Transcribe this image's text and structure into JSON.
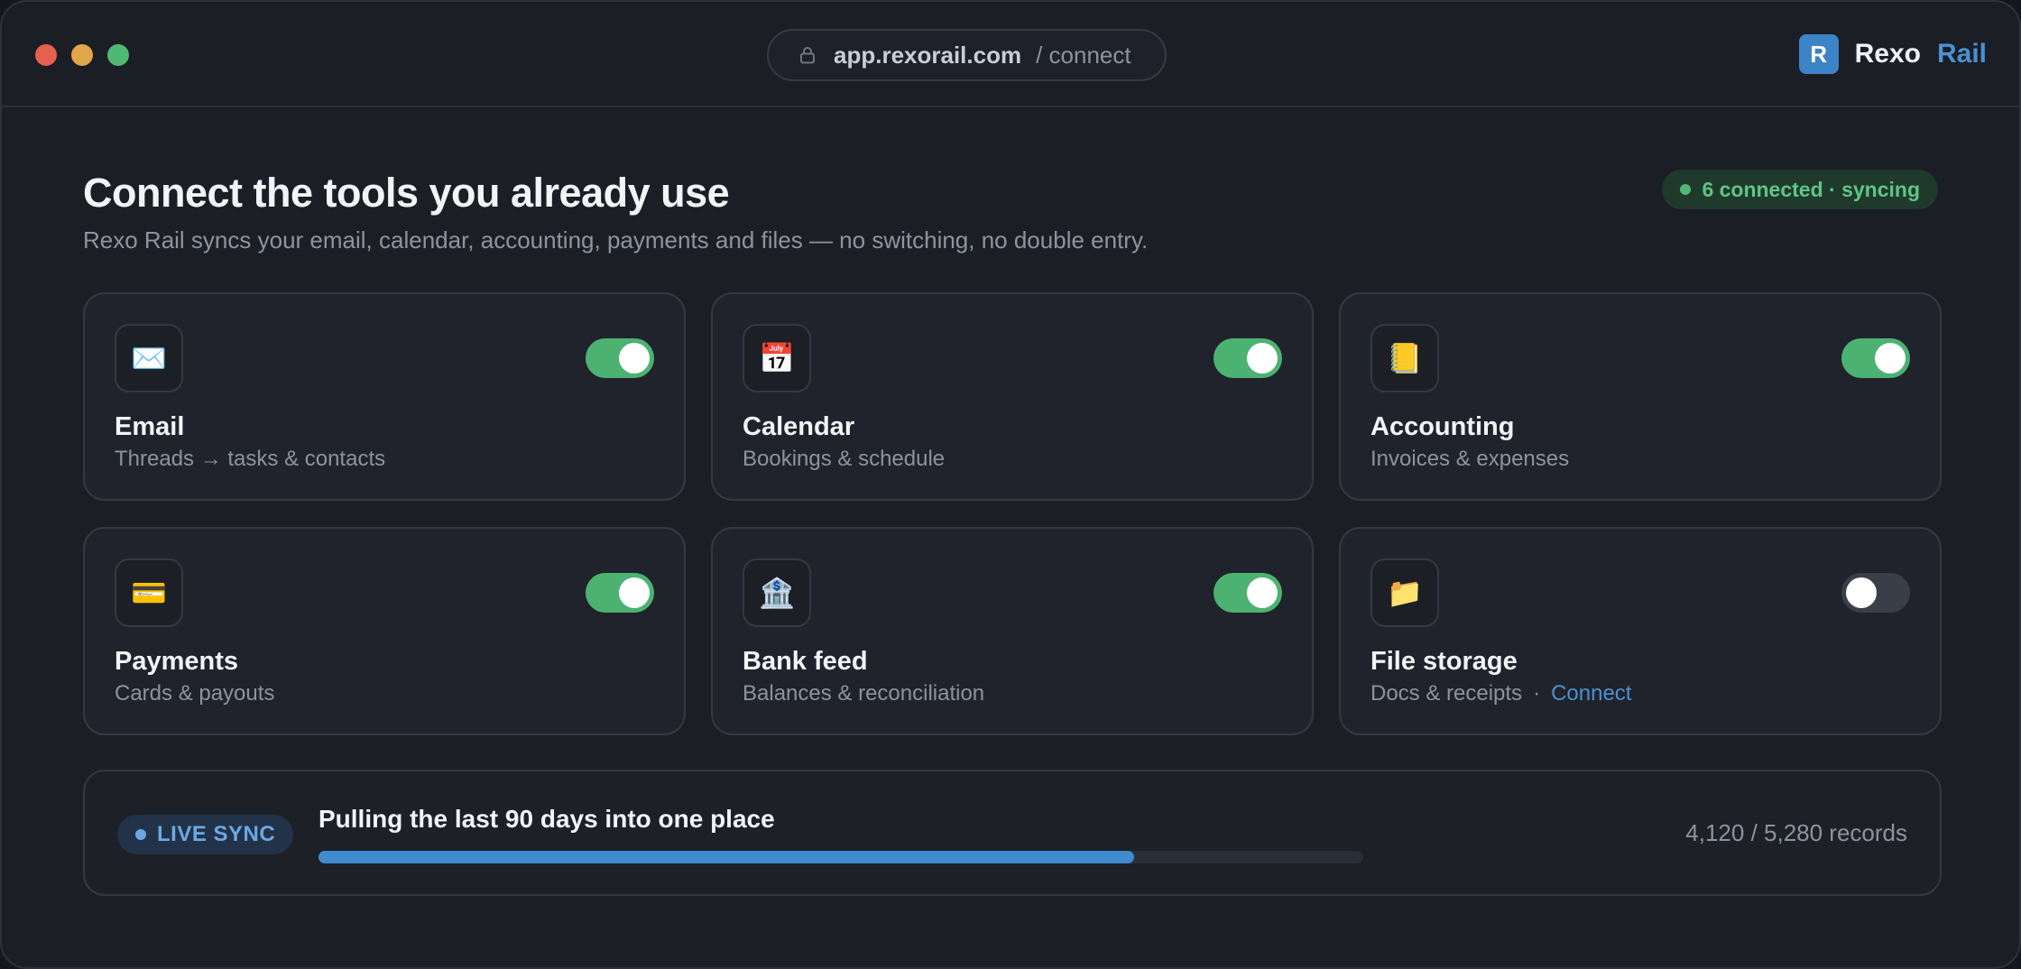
{
  "window": {
    "url_host": "app.rexorail.com",
    "url_path": "/ connect"
  },
  "brand": {
    "logo_letter": "R",
    "name_part1": "Rexo",
    "name_part2": "Rail"
  },
  "header": {
    "title": "Connect the tools you already use",
    "subtitle": "Rexo Rail syncs your email, calendar, accounting, payments and files — no switching, no double entry.",
    "status": "6 connected · syncing"
  },
  "integrations": [
    {
      "name": "Email",
      "desc": "Threads → tasks & contacts",
      "icon": "envelope-icon",
      "glyph": "✉️",
      "enabled": true
    },
    {
      "name": "Calendar",
      "desc": "Bookings & schedule",
      "icon": "calendar-icon",
      "glyph": "📅",
      "enabled": true
    },
    {
      "name": "Accounting",
      "desc": "Invoices & expenses",
      "icon": "ledger-icon",
      "glyph": "📒",
      "enabled": true
    },
    {
      "name": "Payments",
      "desc": "Cards & payouts",
      "icon": "credit-card-icon",
      "glyph": "💳",
      "enabled": true
    },
    {
      "name": "Bank feed",
      "desc": "Balances & reconciliation",
      "icon": "bank-icon",
      "glyph": "🏦",
      "enabled": true
    },
    {
      "name": "File storage",
      "desc": "Docs & receipts",
      "icon": "folder-icon",
      "glyph": "📁",
      "enabled": false,
      "separator": "·",
      "action": "Connect"
    }
  ],
  "sync": {
    "badge": "LIVE SYNC",
    "title": "Pulling the last 90 days into one place",
    "records_done": 4120,
    "records_total": 5280,
    "count_text": "4,120 / 5,280 records"
  },
  "colors": {
    "accent_blue": "#4a90d0",
    "toggle_on": "#4cb272",
    "status_green": "#5fc585"
  }
}
